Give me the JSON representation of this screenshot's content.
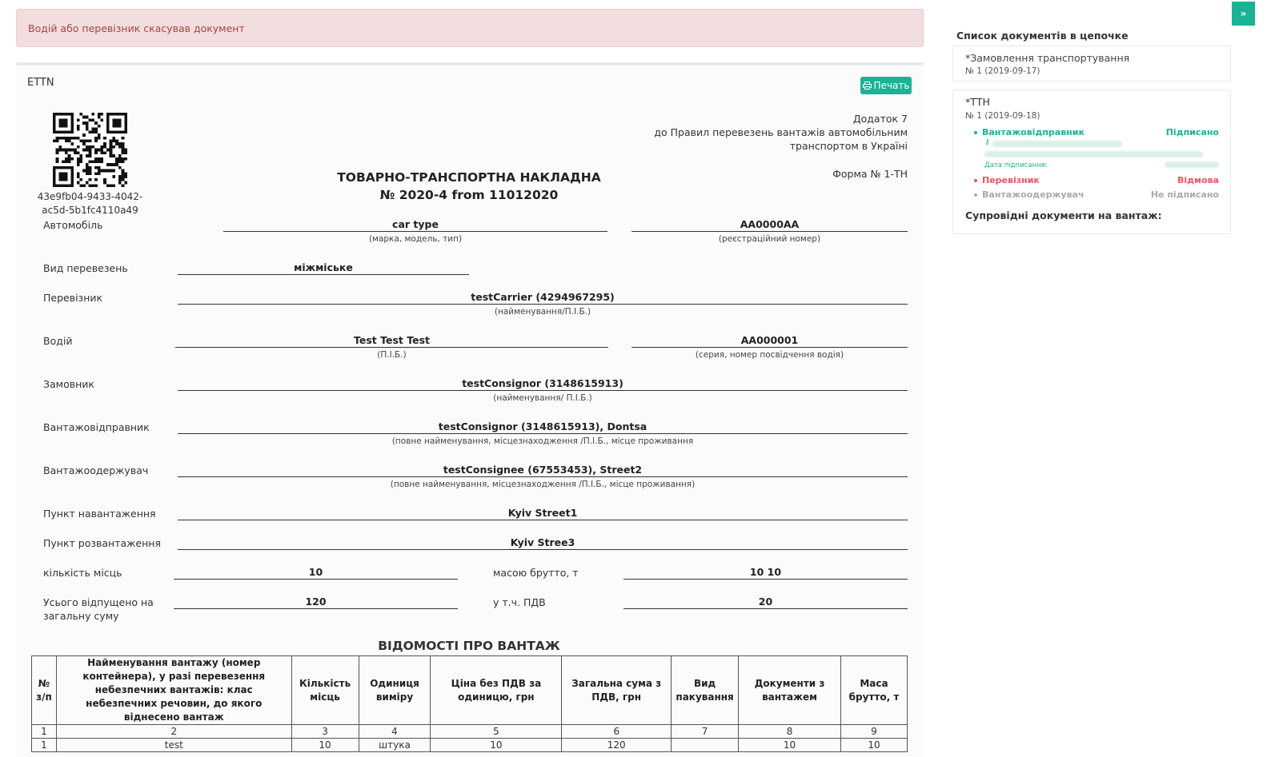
{
  "alert": {
    "text": "Водій або перевізник скасував документ"
  },
  "panel": {
    "title": "ETTN",
    "print_label": "Печать"
  },
  "qr": {
    "uuid": "43e9fb04-9433-4042-ac5d-5b1fc4110a49"
  },
  "header": {
    "appendix_line1": "Додаток 7",
    "appendix_line2": "до Правил перевезень вантажів автомобільним",
    "appendix_line3": "транспортом в Україні",
    "form_no": "Форма № 1-ТН",
    "title": "ТОВАРНО-ТРАНСПОРТНА НАКЛАДНА",
    "number": "№ 2020-4 from 11012020"
  },
  "fields": {
    "vehicle_label": "Автомобіль",
    "vehicle_value": "car type",
    "vehicle_sub": "(марка, модель, тип)",
    "reg_value": "AA0000AA",
    "reg_sub": "(реєстраційний номер)",
    "transport_type_label": "Вид перевезень",
    "transport_type_value": "міжміське",
    "carrier_label": "Перевізник",
    "carrier_value": "testCarrier (4294967295)",
    "carrier_sub": "(найменування/П.І.Б.)",
    "driver_label": "Водій",
    "driver_value": "Test Test Test",
    "driver_sub": "(П.І.Б.)",
    "license_value": "AA000001",
    "license_sub": "(серия, номер посвідчення водія)",
    "customer_label": "Замовник",
    "customer_value": "testConsignor (3148615913)",
    "customer_sub": "(найменування/ П.І.Б.)",
    "consignor_label": "Вантажовідправник",
    "consignor_value": "testConsignor (3148615913), Dontsa",
    "consignor_sub": "(повне найменування, місцезнаходження /П.І.Б., місце проживання",
    "consignee_label": "Вантажоодержувач",
    "consignee_value": "testConsignee (67553453), Street2",
    "consignee_sub": "(повне найменування, місцезнаходження /П.І.Б., місце проживання)",
    "loading_label": "Пункт навантаження",
    "loading_value": "Kyiv Street1",
    "unloading_label": "Пункт розвантаження",
    "unloading_value": "Kyiv Stree3",
    "places_label": "кількість місць",
    "places_value": "10",
    "gross_label": "масою брутто, т",
    "gross_value": "10 10",
    "total_label_1": "Усього відпущено на",
    "total_label_2": "загальну суму",
    "total_value": "120",
    "vat_label": "у т.ч. ПДВ",
    "vat_value": "20"
  },
  "cargo": {
    "title": "ВІДОМОСТІ ПРО ВАНТАЖ",
    "headers": [
      "№ з/п",
      "Найменування вантажу (номер контейнера), у разі перевезення небезпечних вантажів: клас небезпечних речовин, до якого віднесено вантаж",
      "Кількість місць",
      "Одиниця виміру",
      "Ціна без ПДВ за одиницю, грн",
      "Загальна сума з ПДВ, грн",
      "Вид пакування",
      "Документи з вантажем",
      "Маса брутто, т"
    ],
    "index_row": [
      "1",
      "2",
      "3",
      "4",
      "5",
      "6",
      "7",
      "8",
      "9"
    ],
    "rows": [
      [
        "1",
        "test",
        "10",
        "штука",
        "10",
        "120",
        "",
        "10",
        "10"
      ]
    ]
  },
  "sidebar": {
    "title": "Список документів в цепочке",
    "doc1_title": "*Замовлення транспортування",
    "doc1_sub": "№ 1 (2019-09-17)",
    "doc2_title": "*ТТН",
    "doc2_sub": "№ 1 (2019-09-18)",
    "signers": [
      {
        "name": "Вантажовідправник",
        "status": "Підписано",
        "color": "#1ab394"
      },
      {
        "name": "Перевізник",
        "status": "Відмова",
        "color": "#ed5565"
      },
      {
        "name": "Вантажоодержувач",
        "status": "Не підписано",
        "color": "#aaaaaa"
      }
    ],
    "sign_date_label": "Дата підписання:",
    "accompanying": "Супровідні документи на вантаж:"
  },
  "toggle": {
    "label": "»"
  }
}
